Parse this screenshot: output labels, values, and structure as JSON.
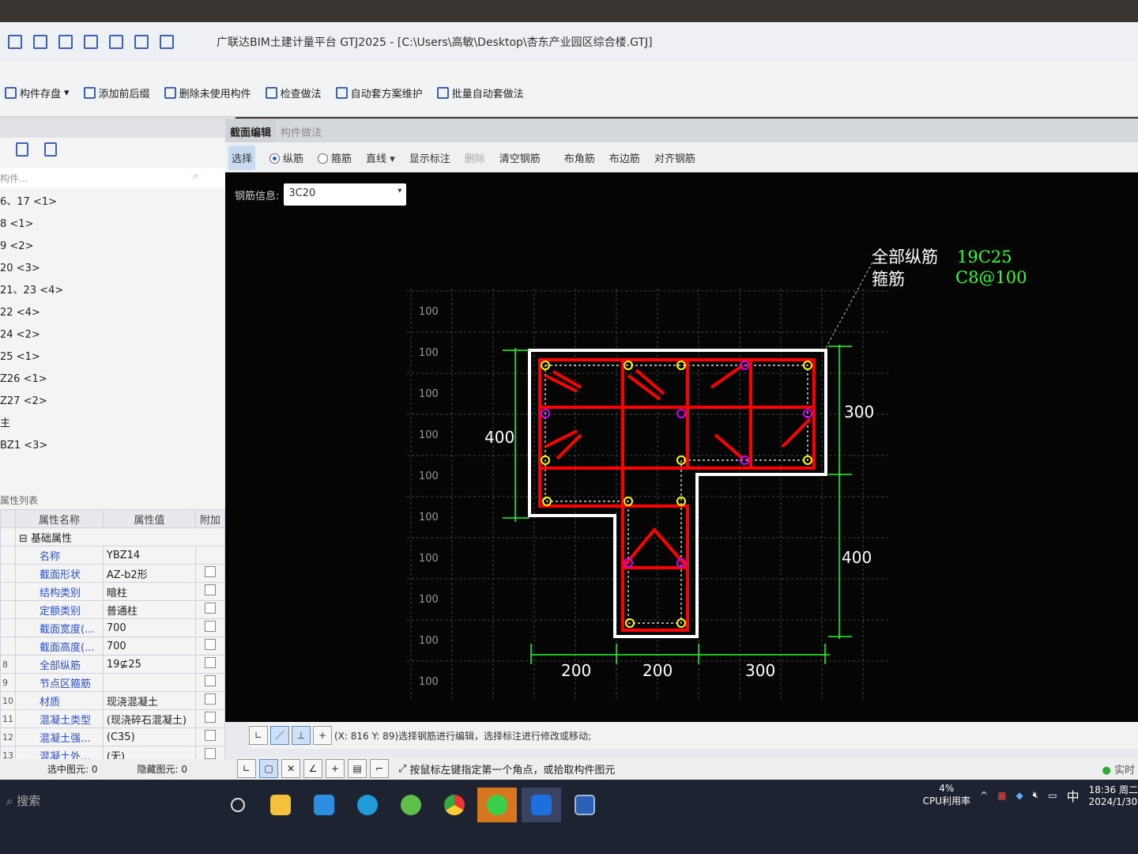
{
  "window": {
    "title": "广联达BIM土建计量平台 GTJ2025 - [C:\\Users\\高敏\\Desktop\\杏东产业园区综合楼.GTJ]"
  },
  "ribbon": {
    "items": [
      "构件存盘",
      "添加前后缀",
      "删除未使用构件",
      "检查做法",
      "自动套方案维护",
      "批量自动套做法"
    ]
  },
  "left_panel": {
    "search_placeholder": "构件...",
    "items": [
      "6、17 <1>",
      "8 <1>",
      "9 <2>",
      "20 <3>",
      "21、23 <4>",
      "22 <4>",
      "24 <2>",
      "25 <1>",
      "Z26 <1>",
      "Z27 <2>",
      "主",
      "BZ1 <3>"
    ]
  },
  "properties": {
    "title": "属性列表",
    "headers": [
      "属性名称",
      "属性值",
      "附加"
    ],
    "group": "基础属性",
    "rows": [
      {
        "num": "",
        "name": "名称",
        "value": "YBZ14"
      },
      {
        "num": "",
        "name": "截面形状",
        "value": "AZ-b2形"
      },
      {
        "num": "",
        "name": "结构类别",
        "value": "暗柱"
      },
      {
        "num": "",
        "name": "定额类别",
        "value": "普通柱"
      },
      {
        "num": "",
        "name": "截面宽度(...",
        "value": "700"
      },
      {
        "num": "",
        "name": "截面高度(...",
        "value": "700"
      },
      {
        "num": "8",
        "name": "全部纵筋",
        "value": "19⊈25"
      },
      {
        "num": "9",
        "name": "节点区箍筋",
        "value": ""
      },
      {
        "num": "10",
        "name": "材质",
        "value": "现浇混凝土"
      },
      {
        "num": "11",
        "name": "混凝土类型",
        "value": "(现浇碎石混凝土)"
      },
      {
        "num": "12",
        "name": "混凝土强...",
        "value": "(C35)"
      },
      {
        "num": "13",
        "name": "混凝土外...",
        "value": "(无)"
      }
    ]
  },
  "status_left": {
    "selected": "选中图元: 0",
    "hidden": "隐藏图元: 0"
  },
  "tabs": [
    "截面编辑",
    "构件做法"
  ],
  "toolbar": {
    "select": "选择",
    "longitudinal": "纵筋",
    "stirrup": "箍筋",
    "line": "直线",
    "show_label": "显示标注",
    "delete": "删除",
    "clear": "清空钢筋",
    "corner": "布角筋",
    "edge": "布边筋",
    "align": "对齐钢筋"
  },
  "rebar_info": {
    "label": "钢筋信息:",
    "value": "3C20"
  },
  "drawing": {
    "grid_label": "100",
    "all_long_label": "全部纵筋",
    "all_long_value": "19C25",
    "stirrup_label": "箍筋",
    "stirrup_value": "C8@100",
    "dims": {
      "left": "400",
      "right_top": "300",
      "right_bottom": "400",
      "bottom": [
        "200",
        "200",
        "300"
      ]
    }
  },
  "canvas_status": "(X: 816 Y: 89)选择钢筋进行编辑，选择标注进行修改或移动;",
  "bottom_status": "按鼠标左键指定第一个角点，或拾取构件图元",
  "realtime": "实时",
  "taskbar": {
    "search": "搜索",
    "cpu_percent": "4%",
    "cpu_label": "CPU利用率",
    "ime": "中",
    "time": "18:36 周二",
    "date": "2024/1/30"
  }
}
